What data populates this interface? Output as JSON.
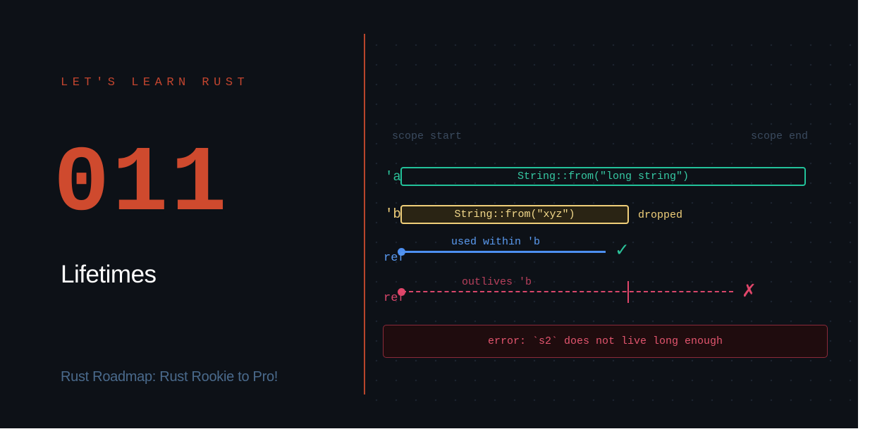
{
  "header": {
    "kicker": "LET'S LEARN RUST",
    "episode": "011",
    "title": "Lifetimes",
    "footer": "Rust Roadmap: Rust Rookie to Pro!"
  },
  "diagram": {
    "scope_start": "scope start",
    "scope_end": "scope end",
    "lifetime_a": {
      "label": "'a",
      "value": "String::from(\"long string\")",
      "color": "#22c29a"
    },
    "lifetime_b": {
      "label": "'b",
      "value": "String::from(\"xyz\")",
      "status": "dropped",
      "color": "#f0cf7a"
    },
    "ref_valid": {
      "label": "ref",
      "caption": "used within 'b",
      "mark": "✓",
      "color": "#4d8ff0"
    },
    "ref_invalid": {
      "label": "ref",
      "caption": "outlives 'b",
      "mark": "✗",
      "color": "#e0466a"
    },
    "error": "error: `s2` does not live long enough"
  },
  "colors": {
    "background": "#0d1117",
    "accent": "#cf4a2e",
    "divider": "#b8452c"
  }
}
